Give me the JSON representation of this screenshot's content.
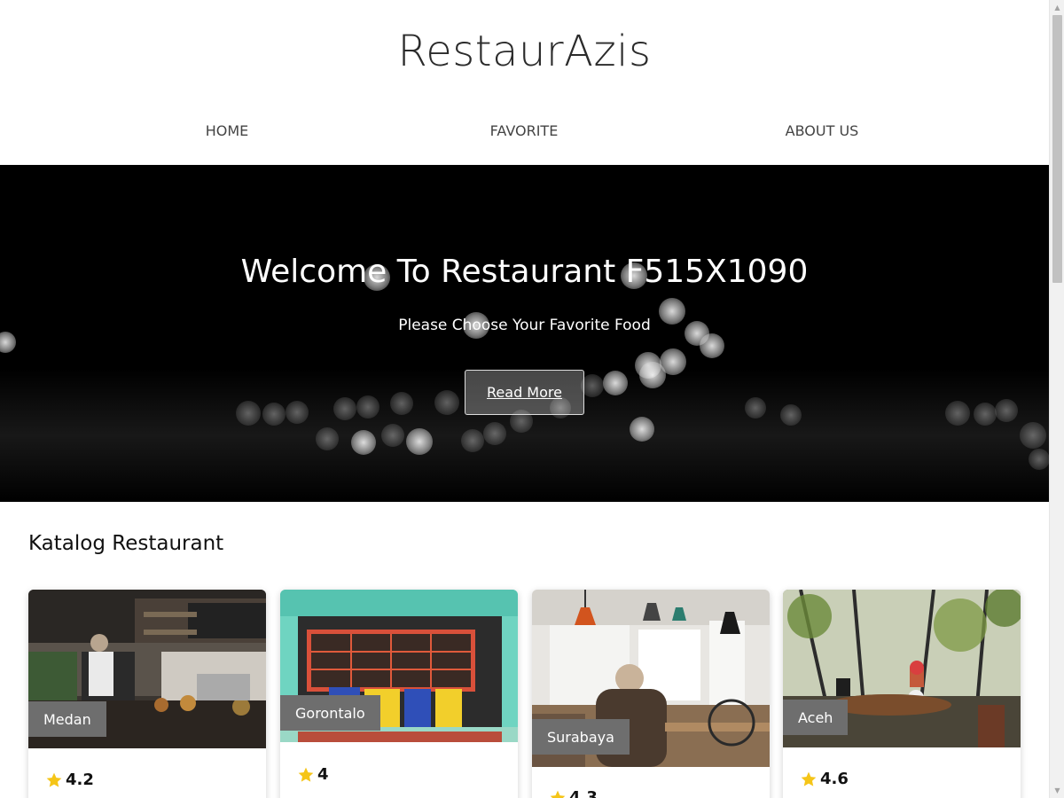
{
  "header": {
    "brand": "RestaurAzis",
    "nav": [
      {
        "label": "HOME"
      },
      {
        "label": "FAVORITE"
      },
      {
        "label": "ABOUT US"
      }
    ]
  },
  "hero": {
    "title": "Welcome To Restaurant F515X1090",
    "subtitle": "Please Choose Your Favorite Food",
    "button_label": "Read More"
  },
  "catalog": {
    "title": "Katalog Restaurant",
    "restaurants": [
      {
        "city": "Medan",
        "rating": "4.2"
      },
      {
        "city": "Gorontalo",
        "rating": "4"
      },
      {
        "city": "Surabaya",
        "rating": "4.3"
      },
      {
        "city": "Aceh",
        "rating": "4.6"
      }
    ]
  },
  "colors": {
    "accent_star": "#f5c518",
    "city_badge": "#6e6e6e",
    "hero_bg": "#000000"
  },
  "icons": {
    "rating": "star-icon"
  }
}
